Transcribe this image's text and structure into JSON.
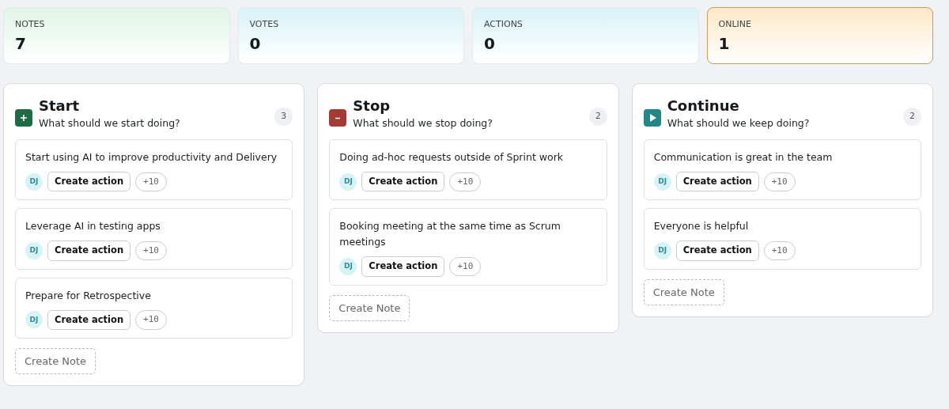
{
  "stats": [
    {
      "label": "NOTES",
      "value": "7",
      "color": "#dff5e6",
      "highlighted": false
    },
    {
      "label": "VOTES",
      "value": "0",
      "color": "#d9f3f8",
      "highlighted": false
    },
    {
      "label": "ACTIONS",
      "value": "0",
      "color": "#d9f3f8",
      "highlighted": false
    },
    {
      "label": "ONLINE",
      "value": "1",
      "color": "#ffe9c7",
      "highlighted": true
    }
  ],
  "columns": [
    {
      "kind": "plus",
      "color": "#1f6b45",
      "title": "Start",
      "subtitle": "What should we start doing?",
      "count": "3",
      "create_label": "Create Note",
      "notes": [
        {
          "text": "Start using AI to improve productivity and Delivery",
          "author": "DJ",
          "action": "Create action",
          "vote": "+10"
        },
        {
          "text": "Leverage AI in testing apps",
          "author": "DJ",
          "action": "Create action",
          "vote": "+10"
        },
        {
          "text": "Prepare for Retrospective",
          "author": "DJ",
          "action": "Create action",
          "vote": "+10"
        }
      ]
    },
    {
      "kind": "minus",
      "color": "#a33a36",
      "title": "Stop",
      "subtitle": "What should we stop doing?",
      "count": "2",
      "create_label": "Create Note",
      "notes": [
        {
          "text": "Doing ad-hoc requests outside of Sprint work",
          "author": "DJ",
          "action": "Create action",
          "vote": "+10"
        },
        {
          "text": "Booking meeting at the same time as Scrum meetings",
          "author": "DJ",
          "action": "Create action",
          "vote": "+10"
        }
      ]
    },
    {
      "kind": "play",
      "color": "#23878a",
      "title": "Continue",
      "subtitle": "What should we keep doing?",
      "count": "2",
      "create_label": "Create Note",
      "notes": [
        {
          "text": "Communication is great in the team",
          "author": "DJ",
          "action": "Create action",
          "vote": "+10"
        },
        {
          "text": "Everyone is helpful",
          "author": "DJ",
          "action": "Create action",
          "vote": "+10"
        }
      ]
    }
  ]
}
